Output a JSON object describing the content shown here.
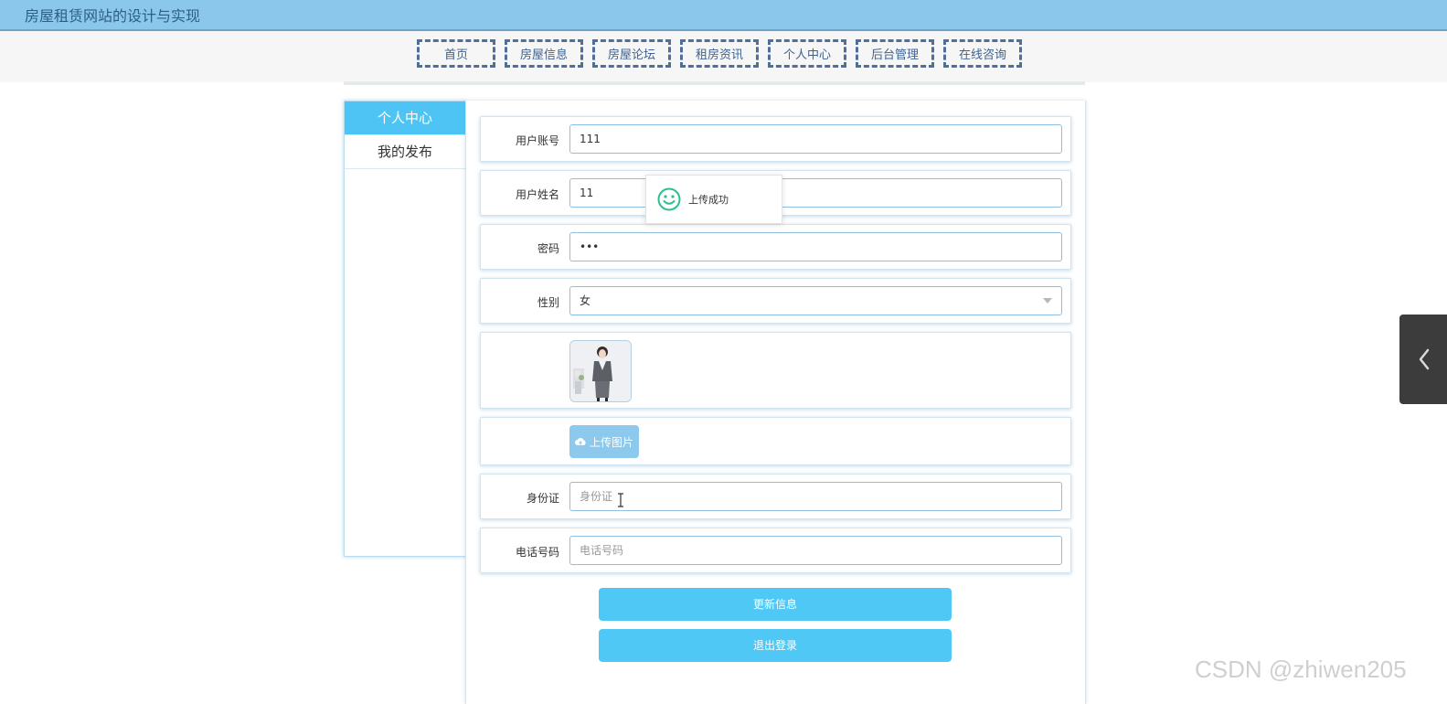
{
  "header": {
    "title": "房屋租赁网站的设计与实现"
  },
  "nav": {
    "items": [
      "首页",
      "房屋信息",
      "房屋论坛",
      "租房资讯",
      "个人中心",
      "后台管理",
      "在线咨询"
    ]
  },
  "sidebar": {
    "items": [
      {
        "label": "个人中心",
        "active": true
      },
      {
        "label": "我的发布",
        "active": false
      }
    ]
  },
  "form": {
    "account": {
      "label": "用户账号",
      "value": "111"
    },
    "name": {
      "label": "用户姓名",
      "value": "11"
    },
    "password": {
      "label": "密码",
      "value": "•••"
    },
    "gender": {
      "label": "性别",
      "value": "女"
    },
    "upload_label": "上传图片",
    "id_card": {
      "label": "身份证",
      "placeholder": "身份证"
    },
    "phone": {
      "label": "电话号码",
      "placeholder": "电话号码"
    }
  },
  "buttons": {
    "update": "更新信息",
    "logout": "退出登录"
  },
  "toast": {
    "message": "上传成功"
  },
  "watermark": "CSDN @zhiwen205",
  "colors": {
    "header": "#8ac7ea",
    "accent": "#4fc8f6",
    "nav_border": "#4d6f9a",
    "toast_icon": "#2ebf91"
  }
}
